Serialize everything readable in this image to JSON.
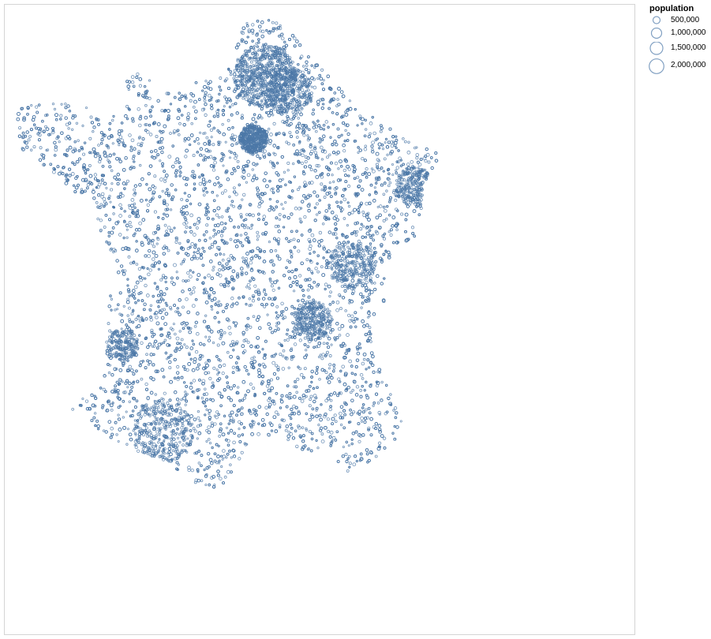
{
  "chart_data": {
    "type": "scatter",
    "mark": "circle-outline",
    "color": "#4c78a8",
    "region": "France",
    "size_field": "population",
    "legend": {
      "title": "population",
      "placement": "top-right",
      "entries": [
        {
          "label": "500,000",
          "value": 500000
        },
        {
          "label": "1,000,000",
          "value": 1000000
        },
        {
          "label": "1,500,000",
          "value": 1500000
        },
        {
          "label": "2,000,000",
          "value": 2000000
        }
      ]
    },
    "axes": "none",
    "grid": false
  }
}
